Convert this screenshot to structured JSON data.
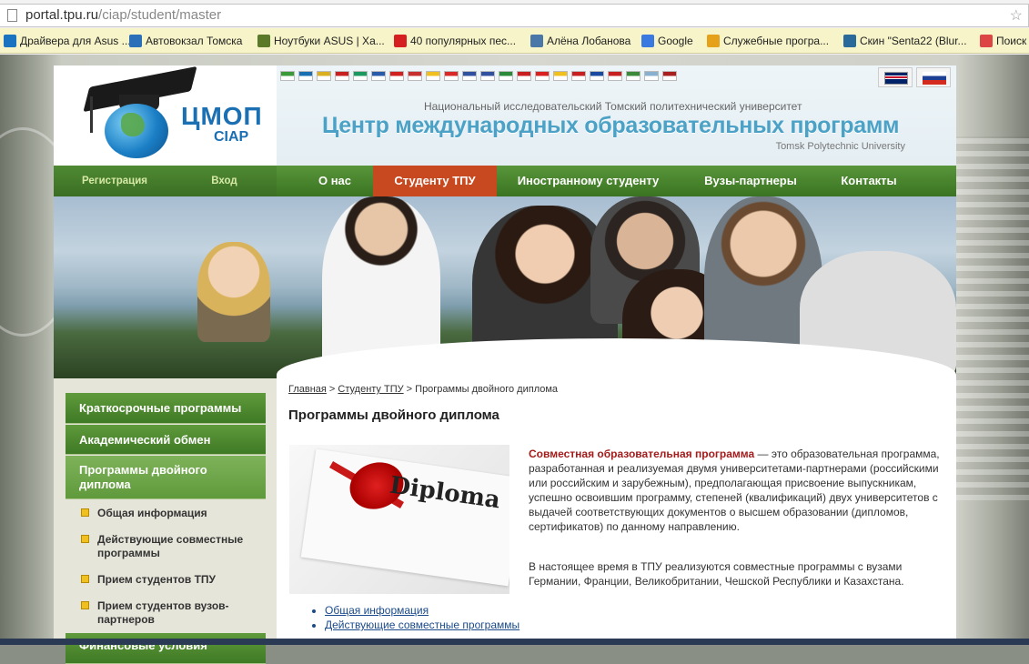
{
  "browser": {
    "url_host": "portal.tpu.ru",
    "url_path": "/ciap/student/master"
  },
  "bookmarks": [
    {
      "label": "Драйвера для Asus ...",
      "icon": "asus-icon",
      "color": "#1a73c0"
    },
    {
      "label": "Автовокзал Томска",
      "icon": "bus-icon",
      "color": "#2a6fb8"
    },
    {
      "label": "Ноутбуки ASUS | Ха...",
      "icon": "asus-n-icon",
      "color": "#5a7a2a"
    },
    {
      "label": "40 популярных пес...",
      "icon": "youtube-icon",
      "color": "#d62020"
    },
    {
      "label": "Алёна Лобанова",
      "icon": "vk-icon",
      "color": "#4a76a8"
    },
    {
      "label": "Google",
      "icon": "google-icon",
      "color": "#3a7ae0"
    },
    {
      "label": "Служебные програ...",
      "icon": "windows-icon",
      "color": "#e6a11a"
    },
    {
      "label": "Скин \"Senta22 (Blur...",
      "icon": "seven-icon",
      "color": "#2a6a9a"
    },
    {
      "label": "Поиск",
      "icon": "star-icon",
      "color": "#d44"
    }
  ],
  "header": {
    "logo_main": "ЦМОП",
    "logo_sub": "CIAP",
    "subtitle": "Национальный исследовательский Томский политехнический университет",
    "title": "Центр международных образовательных программ",
    "tagline": "Tomsk Polytechnic University"
  },
  "flags": [
    "#3a9a3a",
    "#1a6fb3",
    "#d8b020",
    "#c82020",
    "#1a9a60",
    "#2a5aaa",
    "#d02020",
    "#c83030",
    "#f0c020",
    "#d82828",
    "#3050a0",
    "#3050a0",
    "#2a8a3a",
    "#c82020",
    "#d82020",
    "#f0c020",
    "#c82020",
    "#1a4aa0",
    "#c82020",
    "#3a8a3a",
    "#8ab0d0",
    "#aa2020"
  ],
  "langs": [
    {
      "code": "en",
      "name": "UK flag"
    },
    {
      "code": "ru",
      "name": "RU flag"
    }
  ],
  "nav": {
    "register": "Регистрация",
    "login": "Вход",
    "items": [
      "О нас",
      "Студенту ТПУ",
      "Иностранному студенту",
      "Вузы-партнеры",
      "Контакты"
    ]
  },
  "sidebar": {
    "items": [
      {
        "label": "Краткосрочные программы"
      },
      {
        "label": "Академический обмен"
      },
      {
        "label": "Программы двойного диплома"
      }
    ],
    "subitems": [
      "Общая информация",
      "Действующие совместные программы",
      "Прием студентов ТПУ",
      "Прием студентов вузов-партнеров"
    ],
    "cut_item": "Финансовые условия"
  },
  "breadcrumb": {
    "home": "Главная",
    "section": "Студенту ТПУ",
    "current": "Программы двойного диплома",
    "sep": " > "
  },
  "page": {
    "title": "Программы двойного диплома",
    "diploma_text": "Diploma",
    "intro_bold": "Совместная образовательная программа",
    "intro_rest": " — это образовательная программа, разработанная и реализуемая двумя университетами-партнерами (российскими или российским и зарубежным), предполагающая присвоение выпускникам, успешно освоившим программу, степеней (квалификаций) двух университетов с выдачей соответствующих документов о высшем образовании (дипломов, сертификатов) по данному направлению.",
    "para2": "В настоящее время в ТПУ реализуются совместные программы с вузами Германии, Франции, Великобритании, Чешской Республики и Казахстана.",
    "links": [
      "Общая информация",
      "Действующие совместные программы"
    ]
  }
}
